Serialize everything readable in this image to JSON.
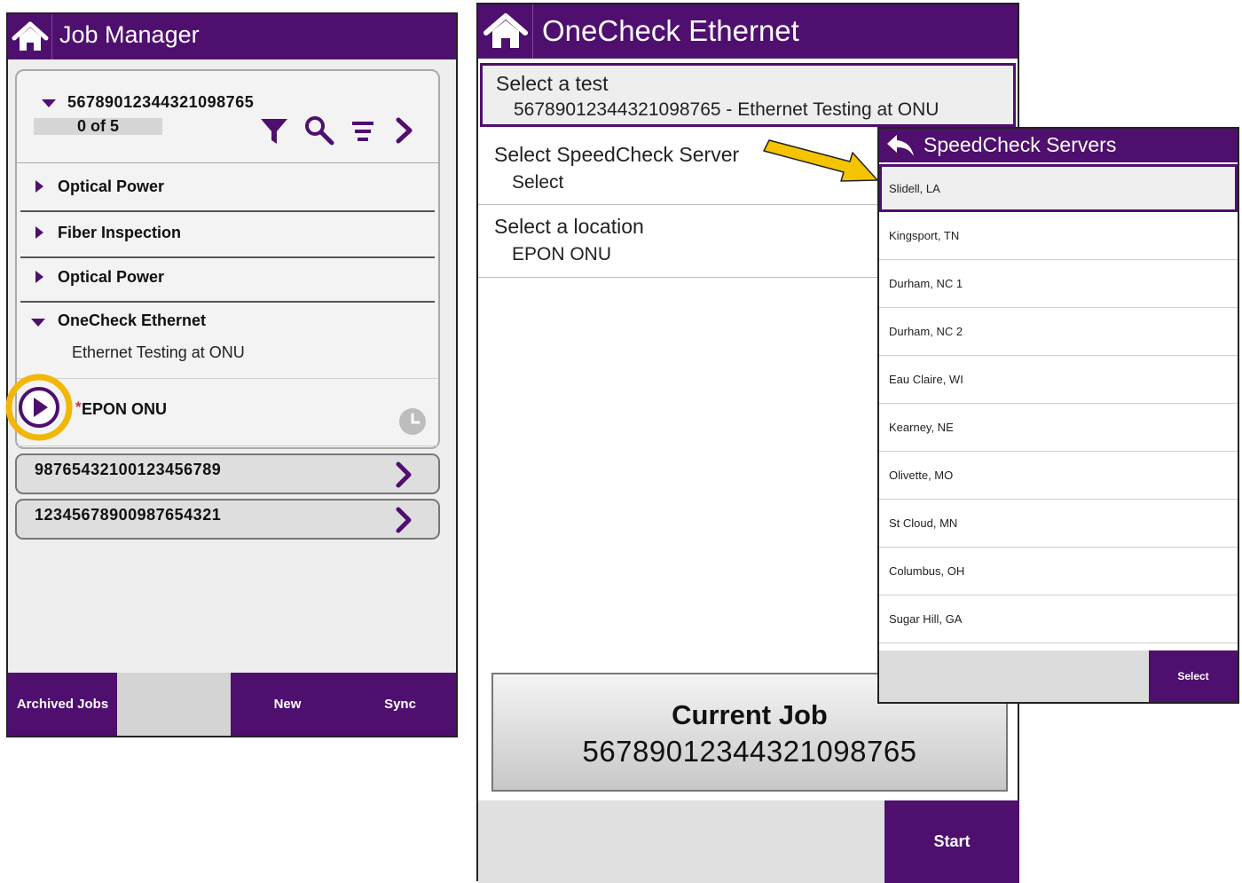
{
  "job_manager": {
    "title": "Job Manager",
    "current_job_number": "56789012344321098765",
    "progress": "0 of 5",
    "tests": [
      {
        "label": "Optical Power"
      },
      {
        "label": "Fiber Inspection"
      },
      {
        "label": "Optical Power"
      },
      {
        "label": "OneCheck Ethernet",
        "sub": "Ethernet Testing at ONU",
        "location": "EPON ONU"
      }
    ],
    "required_marker": "*",
    "other_jobs": [
      "98765432100123456789",
      "12345678900987654321"
    ],
    "bottom": {
      "archived": "Archived Jobs",
      "new": "New",
      "sync": "Sync"
    }
  },
  "onecheck": {
    "title": "OneCheck Ethernet",
    "select_test_label": "Select a test",
    "select_test_value": "56789012344321098765 - Ethernet Testing at ONU",
    "server_label": "Select SpeedCheck Server",
    "server_value": "Select",
    "location_label": "Select a location",
    "location_value": "EPON ONU",
    "current_job_label": "Current Job",
    "current_job_value": "56789012344321098765",
    "start_label": "Start"
  },
  "speedcheck": {
    "title": "SpeedCheck Servers",
    "servers": [
      "Slidell, LA",
      "Kingsport, TN",
      "Durham, NC 1",
      "Durham, NC 2",
      "Eau Claire, WI",
      "Kearney, NE",
      "Olivette, MO",
      "St Cloud, MN",
      "Columbus, OH",
      "Sugar Hill, GA"
    ],
    "selected_index": 0,
    "select_label": "Select"
  },
  "colors": {
    "primary": "#4f0f6e",
    "highlight_ring": "#f2b705",
    "arrow": "#f5c400",
    "required": "#d32f2f"
  }
}
